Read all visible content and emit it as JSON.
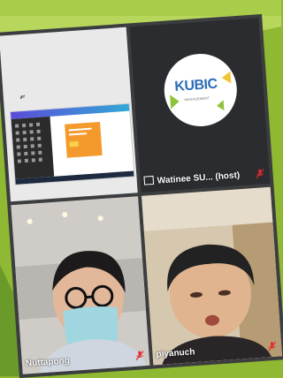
{
  "tiles": {
    "screen_share": {},
    "host": {
      "logo_text": "KUBIC",
      "logo_sub": "MANAGEMENT",
      "name": "Watinee SU... (host)"
    },
    "participant_1": {
      "name": "Nuttapong"
    },
    "participant_2": {
      "name": "piyanuch"
    }
  },
  "icons": {
    "muted_mic": "muted-mic-icon",
    "share": "screen-share-icon"
  },
  "colors": {
    "background": "#8fb833",
    "mute_red": "#e3292c",
    "tile_gap": "#3b3d3f"
  }
}
